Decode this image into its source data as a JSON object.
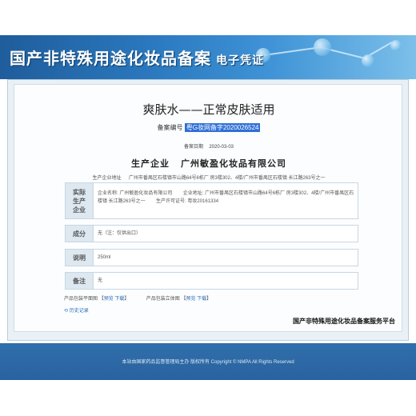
{
  "banner": {
    "title": "国产非特殊用途化妆品备案",
    "subtitle": "电子凭证"
  },
  "record": {
    "product_name": "爽肤水——正常皮肤适用",
    "reg_label": "备案编号",
    "reg_value": "粤G妆网备字2020026524",
    "date_label": "备案日期",
    "date_value": "2020-03-03",
    "company_label": "生产企业",
    "company_name": "广州敏盈化妆品有限公司",
    "address_label": "生产企业地址",
    "address_value": "广州市番禺区石楼镇市山路64号6栋厂 房3楼302、4楼/广州市番禺区石楼镇 长江路263号之一"
  },
  "tables": {
    "enterprise": {
      "header": "实际生产企业",
      "name_label": "企业名称:",
      "name_value": "广州敏盈化妆品有限公司",
      "addr_label": "企业地址:",
      "addr_value": "广州市番禺区石楼镇市山路64号6栋厂 房3楼302、4楼/广州市番禺区石楼镇 长江路263号之一",
      "license_label": "生产许可证号:",
      "license_value": "粤妆20161334"
    },
    "ingredients": {
      "header": "成分",
      "value": "无（注：仅供出口）"
    },
    "description": {
      "header": "说明",
      "value": "250ml"
    },
    "remark": {
      "header": "备注",
      "value": "无"
    }
  },
  "packaging": {
    "flat_label": "产品包装平面图",
    "flat_preview": "预览",
    "flat_download": "下载",
    "solid_label": "产品包装立体图",
    "solid_preview": "预览",
    "solid_download": "下载",
    "history": "历史记录"
  },
  "platform_title": "国产非特殊用途化妆品备案服务平台",
  "footer": {
    "text": "本站由国家药品监督管理局主办 版权所有 Copyright © NMPA All Rights Reserved"
  }
}
